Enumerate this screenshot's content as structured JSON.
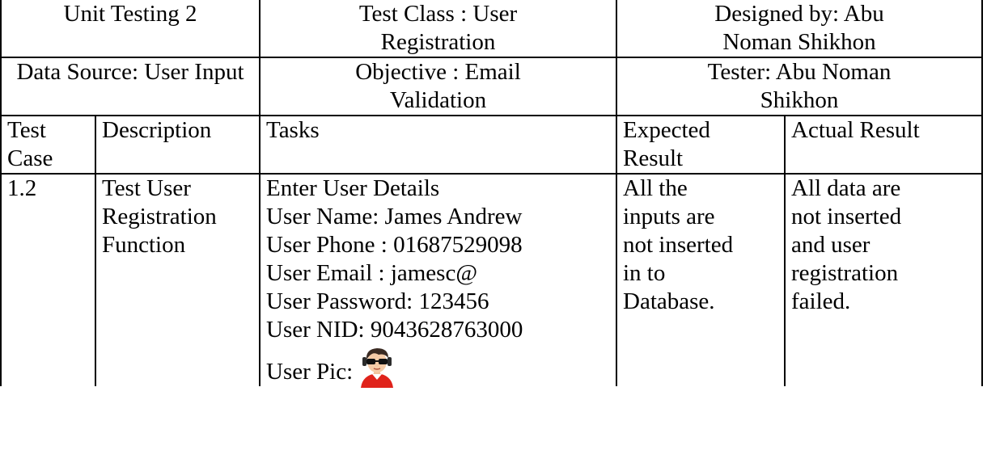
{
  "header": {
    "unit_testing": "Unit Testing 2",
    "test_class_line1": "Test Class : User",
    "test_class_line2": "Registration",
    "designed_by_line1": "Designed by: Abu",
    "designed_by_line2": "Noman Shikhon",
    "data_source": "Data Source: User Input",
    "objective_line1": "Objective : Email",
    "objective_line2": "Validation",
    "tester_line1": "Tester: Abu Noman",
    "tester_line2": "Shikhon"
  },
  "columns": {
    "test_case_line1": "Test",
    "test_case_line2": "Case",
    "description": "Description",
    "tasks": "Tasks",
    "expected_line1": "Expected",
    "expected_line2": "Result",
    "actual": "Actual Result"
  },
  "row": {
    "test_case": "1.2",
    "description_lines": [
      "Test User",
      "Registration",
      "Function"
    ],
    "task_lines": [
      "Enter User Details",
      "User Name: James Andrew",
      "User Phone : 01687529098",
      "User Email : jamesc@",
      "User Password: 123456",
      "User NID: 9043628763000"
    ],
    "user_pic_label": "User Pic:",
    "avatar_icon": "user-avatar-icon",
    "expected_lines": [
      "All the",
      "inputs are",
      "not inserted",
      "in to",
      "Database."
    ],
    "actual_lines": [
      "All data are",
      "not inserted",
      "and user",
      "registration",
      "failed."
    ]
  }
}
